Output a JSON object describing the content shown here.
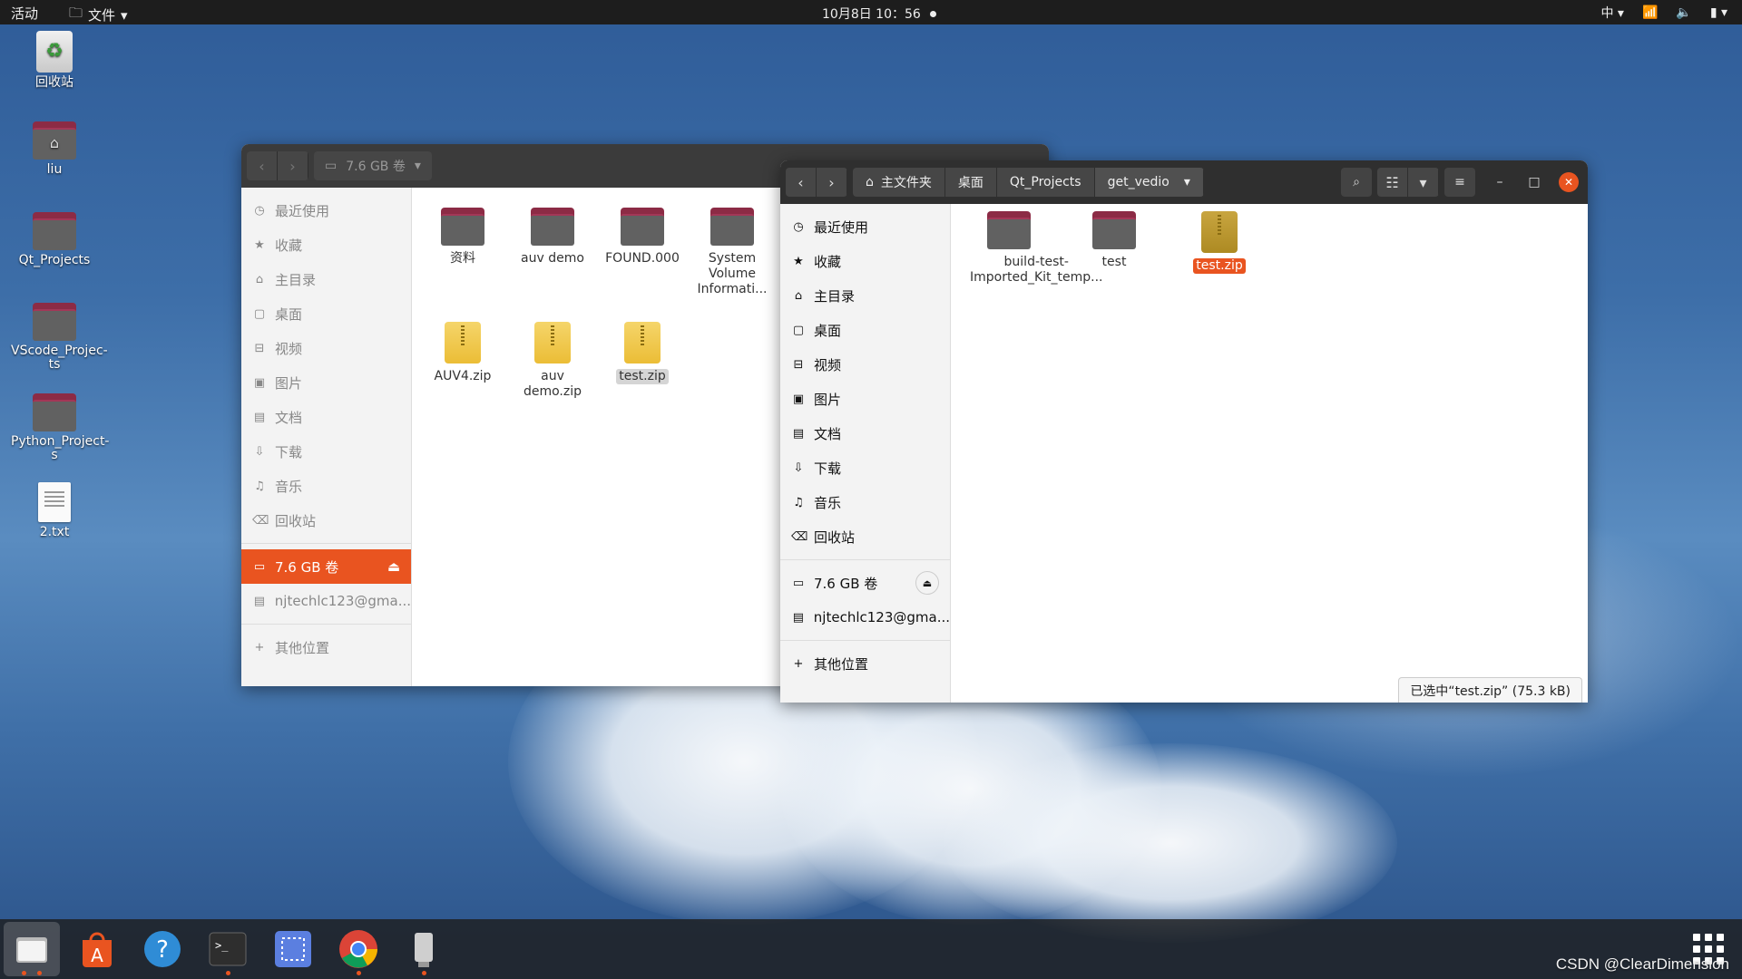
{
  "topbar": {
    "activities": "活动",
    "app_menu": "文件",
    "clock": "10月8日 10：56",
    "input_method": "中"
  },
  "desktop": {
    "icons": [
      {
        "label": "回收站",
        "icon": "trash-icon"
      },
      {
        "label": "liu",
        "icon": "home-folder-icon"
      },
      {
        "label": "Qt_Projects",
        "icon": "folder-icon"
      },
      {
        "label": "VScode_Projec-ts",
        "icon": "folder-icon"
      },
      {
        "label": "Python_Project-s",
        "icon": "folder-icon"
      },
      {
        "label": "2.txt",
        "icon": "text-file-icon"
      }
    ]
  },
  "window_back": {
    "location": "7.6 GB 卷",
    "sidebar": {
      "recent": "最近使用",
      "starred": "收藏",
      "home": "主目录",
      "desktop": "桌面",
      "videos": "视频",
      "pictures": "图片",
      "documents": "文档",
      "downloads": "下载",
      "music": "音乐",
      "trash": "回收站",
      "volume": "7.6 GB 卷",
      "account": "njtechlc123@gma...",
      "other": "其他位置"
    },
    "files": [
      {
        "name": "资料",
        "type": "folder"
      },
      {
        "name": "auv demo",
        "type": "folder"
      },
      {
        "name": "FOUND.000",
        "type": "folder"
      },
      {
        "name": "System Volume Informati...",
        "type": "folder"
      },
      {
        "name": "AUV4.zip",
        "type": "zip"
      },
      {
        "name": "auv demo.zip",
        "type": "zip"
      },
      {
        "name": "test.zip",
        "type": "zip"
      }
    ]
  },
  "window_front": {
    "breadcrumbs": [
      "主文件夹",
      "桌面",
      "Qt_Projects",
      "get_vedio"
    ],
    "sidebar": {
      "recent": "最近使用",
      "starred": "收藏",
      "home": "主目录",
      "desktop": "桌面",
      "videos": "视频",
      "pictures": "图片",
      "documents": "文档",
      "downloads": "下载",
      "music": "音乐",
      "trash": "回收站",
      "volume": "7.6 GB 卷",
      "account": "njtechlc123@gma...",
      "other": "其他位置"
    },
    "files": [
      {
        "name": "build-test-Imported_Kit_temp...",
        "type": "folder"
      },
      {
        "name": "test",
        "type": "folder"
      },
      {
        "name": "test.zip",
        "type": "zip",
        "selected": true
      }
    ],
    "status": "已选中“test.zip” (75.3 kB)"
  },
  "dock": {
    "apps": [
      "files-app-icon",
      "software-center-icon",
      "help-icon",
      "terminal-icon",
      "screenshot-icon",
      "chrome-icon",
      "usb-drive-icon"
    ]
  },
  "watermark": "CSDN @ClearDimension",
  "colors": {
    "accent": "#e95420",
    "topbar": "#1d1d1d",
    "header": "#2f2f2f"
  }
}
